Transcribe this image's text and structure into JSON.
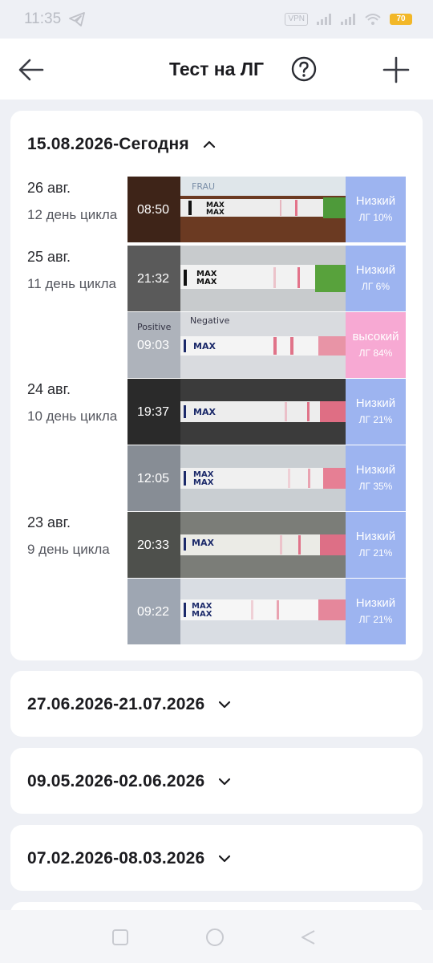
{
  "status": {
    "time": "11:35",
    "vpn": "VPN",
    "battery": "70"
  },
  "appbar": {
    "title": "Тест на ЛГ",
    "back_icon": "arrow-left-icon",
    "help_icon": "question-circle-icon",
    "add_icon": "plus-icon"
  },
  "current": {
    "range": "15.08.2026-Сегодня",
    "days": [
      {
        "date": "26 авг.",
        "cycle": "12 день цикла"
      },
      {
        "date": "25 авг.",
        "cycle": "11 день цикла"
      },
      {
        "date": "24 авг.",
        "cycle": "10 день цикла"
      },
      {
        "date": "23 авг.",
        "cycle": "9 день цикла"
      }
    ],
    "entries": [
      {
        "time": "08:50",
        "level": "Низкий",
        "value": "ЛГ 10%"
      },
      {
        "time": "21:32",
        "level": "Низкий",
        "value": "ЛГ 6%"
      },
      {
        "time": "09:03",
        "level": "высокий",
        "value": "ЛГ 84%"
      },
      {
        "time": "19:37",
        "level": "Низкий",
        "value": "ЛГ 21%"
      },
      {
        "time": "12:05",
        "level": "Низкий",
        "value": "ЛГ 35%"
      },
      {
        "time": "20:33",
        "level": "Низкий",
        "value": "ЛГ 21%"
      },
      {
        "time": "09:22",
        "level": "Низкий",
        "value": "ЛГ 21%"
      }
    ]
  },
  "past_cycles": [
    {
      "range": "27.06.2026-21.07.2026"
    },
    {
      "range": "09.05.2026-02.06.2026"
    },
    {
      "range": "07.02.2026-08.03.2026"
    }
  ],
  "strip_text": {
    "max": "MAX",
    "negative": "Negative",
    "positive": "Positive",
    "brand": "FRAU"
  },
  "colors": {
    "low": "#9db4f0",
    "high": "#f7a9d3",
    "test_line": "#e3738a",
    "accent": "#1b1b1f"
  }
}
